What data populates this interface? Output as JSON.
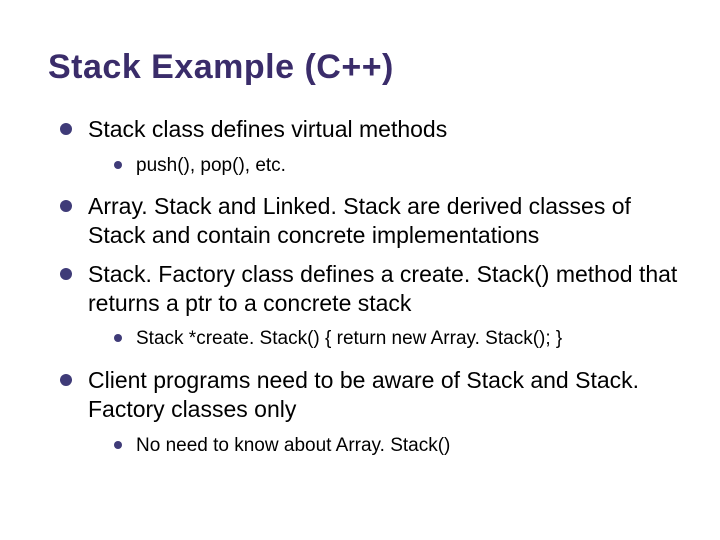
{
  "title": "Stack Example (C++)",
  "items": {
    "p1": "Stack class defines virtual methods",
    "p1_sub": "push(), pop(), etc.",
    "p2": "Array. Stack and Linked. Stack are derived classes of Stack and contain concrete implementations",
    "p3": "Stack. Factory class defines a create. Stack() method that returns a ptr to a concrete stack",
    "p3_sub": "Stack *create. Stack() { return new Array. Stack(); }",
    "p4": "Client programs need to be aware of Stack and Stack. Factory classes only",
    "p4_sub": "No need to know about Array. Stack()"
  }
}
